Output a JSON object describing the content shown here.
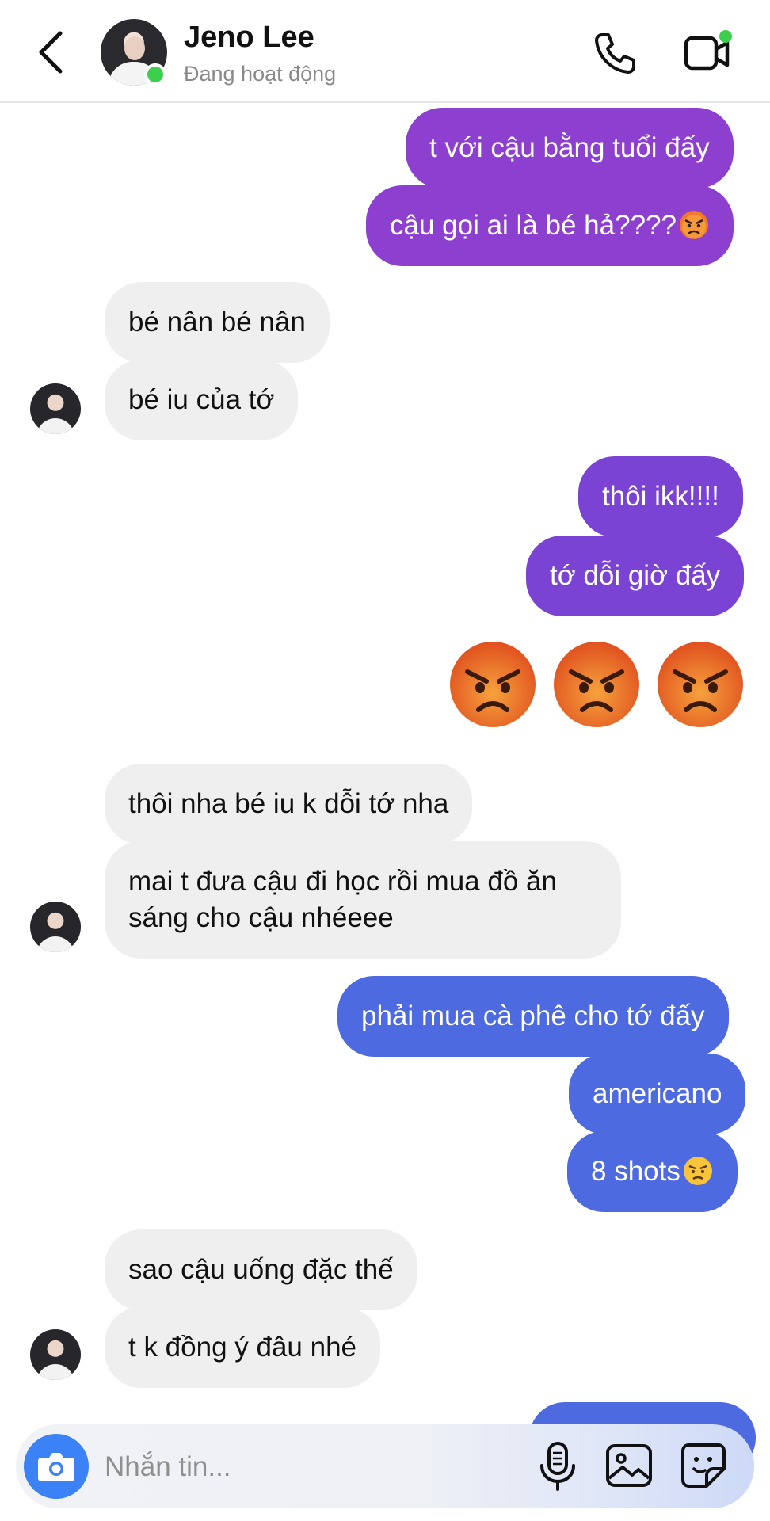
{
  "header": {
    "contact_name": "Jeno Lee",
    "status_text": "Đang hoạt động"
  },
  "messages": [
    {
      "side": "out",
      "text": "t với cậu bằng tuổi đấy"
    },
    {
      "side": "out",
      "text": "cậu gọi ai là bé hả????",
      "emoji": "angry-face"
    },
    {
      "side": "in",
      "text": "bé nân bé nân"
    },
    {
      "side": "in",
      "text": "bé iu của tớ"
    },
    {
      "side": "out",
      "text": "thôi ikk!!!!"
    },
    {
      "side": "out",
      "text": "tớ dỗi giờ đấy"
    },
    {
      "side": "out",
      "emoji": "angry-face x3"
    },
    {
      "side": "in",
      "text": "thôi nha bé iu k dỗi tớ nha"
    },
    {
      "side": "in",
      "line1": "mai t đưa cậu đi học rồi mua đồ ăn",
      "line2": "sáng cho cậu nhéeee"
    },
    {
      "side": "out",
      "text": "phải mua cà phê cho tớ đấy"
    },
    {
      "side": "out",
      "text": "americano"
    },
    {
      "side": "out",
      "text": "8 shots",
      "emoji": "annoyed-face"
    },
    {
      "side": "in",
      "text": "sao cậu uống đặc thế"
    },
    {
      "side": "in",
      "text": "t k đồng ý đâu nhé"
    }
  ],
  "composer": {
    "placeholder": "Nhắn tin..."
  },
  "colors": {
    "outgoing_purple": "#8d3fd0",
    "outgoing_blue": "#4e6ae0",
    "incoming_gray": "#efefef",
    "online_green": "#3ccf4e",
    "camera_blue": "#3b82f6"
  }
}
